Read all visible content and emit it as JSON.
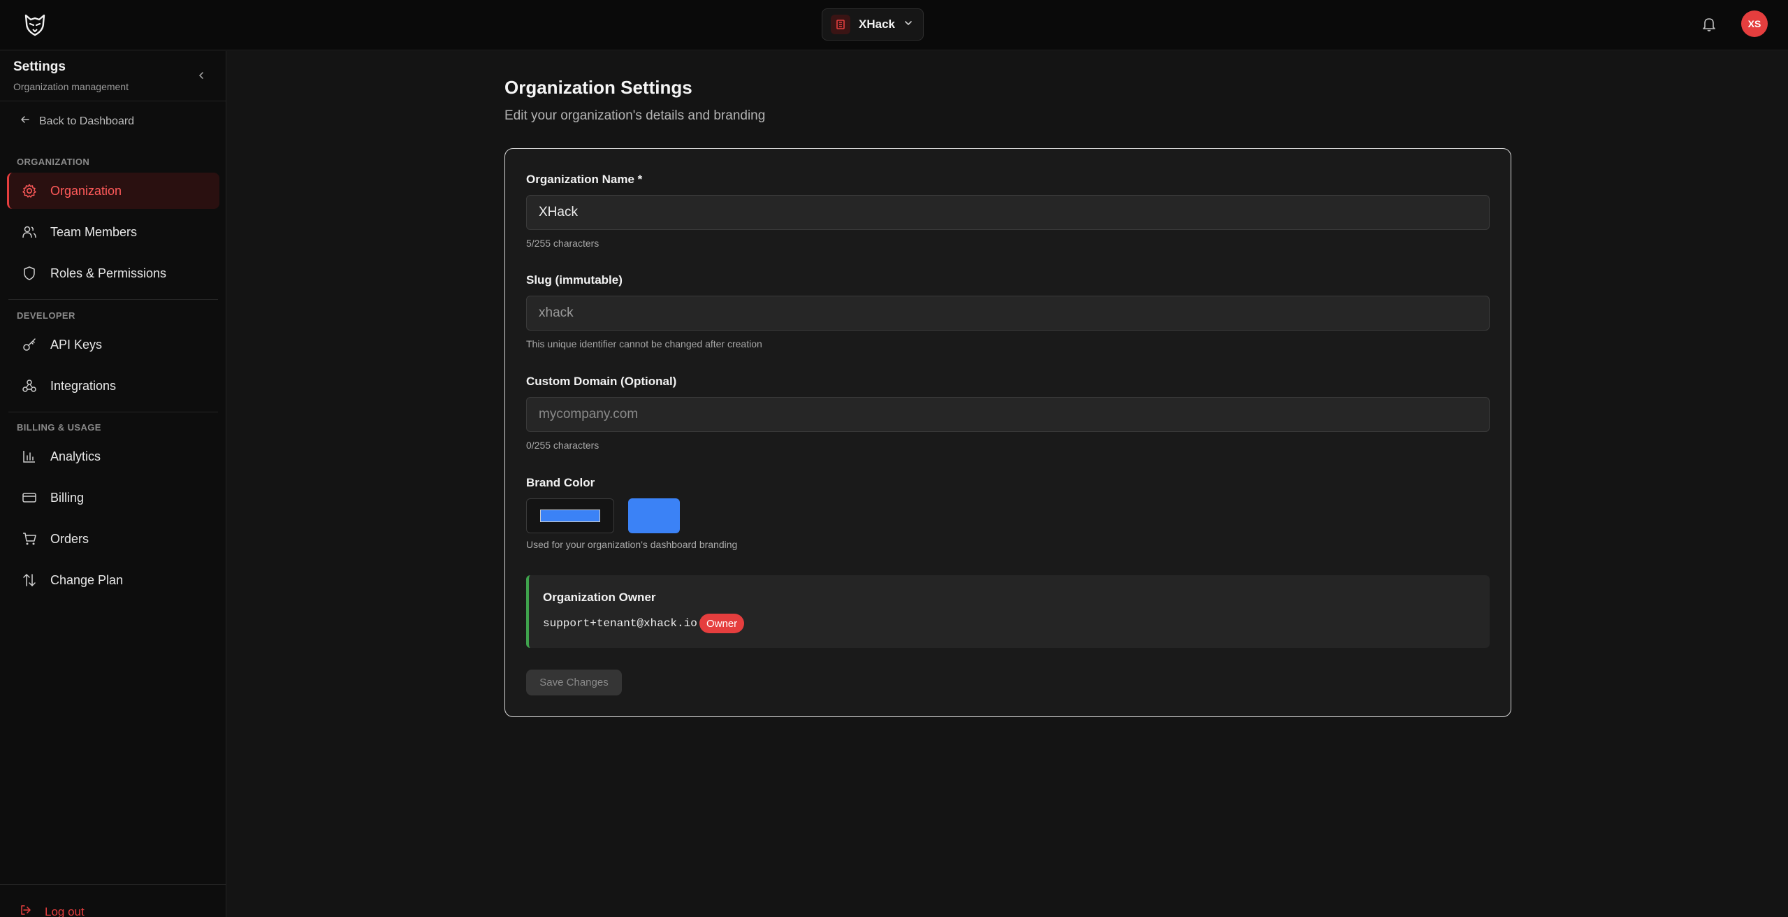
{
  "header": {
    "logo_icon": "wolf-logo-icon",
    "org_name": "XHack",
    "org_icon": "organization-icon",
    "chevron_icon": "chevron-down-icon",
    "bell_icon": "bell-icon",
    "avatar_initials": "XS",
    "avatar_color": "#e53e3e"
  },
  "sidebar": {
    "title": "Settings",
    "subtitle": "Organization management",
    "back_label": "Back to Dashboard",
    "logout_label": "Log out",
    "sections": [
      {
        "label": "ORGANIZATION",
        "items": [
          {
            "label": "Organization",
            "icon": "gear-icon",
            "active": true
          },
          {
            "label": "Team Members",
            "icon": "users-icon"
          },
          {
            "label": "Roles & Permissions",
            "icon": "shield-icon"
          }
        ]
      },
      {
        "label": "DEVELOPER",
        "items": [
          {
            "label": "API Keys",
            "icon": "key-icon"
          },
          {
            "label": "Integrations",
            "icon": "webhook-icon"
          }
        ]
      },
      {
        "label": "BILLING & USAGE",
        "items": [
          {
            "label": "Analytics",
            "icon": "bar-chart-icon"
          },
          {
            "label": "Billing",
            "icon": "credit-card-icon"
          },
          {
            "label": "Orders",
            "icon": "cart-icon"
          },
          {
            "label": "Change Plan",
            "icon": "arrows-up-down-icon"
          }
        ]
      }
    ]
  },
  "main": {
    "title": "Organization Settings",
    "subtitle": "Edit your organization's details and branding",
    "form": {
      "name_label": "Organization Name *",
      "name_value": "XHack",
      "name_hint": "5/255 characters",
      "slug_label": "Slug (immutable)",
      "slug_value": "xhack",
      "slug_hint": "This unique identifier cannot be changed after creation",
      "domain_label": "Custom Domain (Optional)",
      "domain_value": "",
      "domain_placeholder": "mycompany.com",
      "domain_hint": "0/255 characters",
      "brand_label": "Brand Color",
      "brand_color": "#3b82f6",
      "brand_hint": "Used for your organization's dashboard branding",
      "owner_title": "Organization Owner",
      "owner_email": "support+tenant@xhack.io",
      "owner_badge": "Owner",
      "owner_accent": "#3fa34d",
      "save_label": "Save Changes"
    }
  }
}
